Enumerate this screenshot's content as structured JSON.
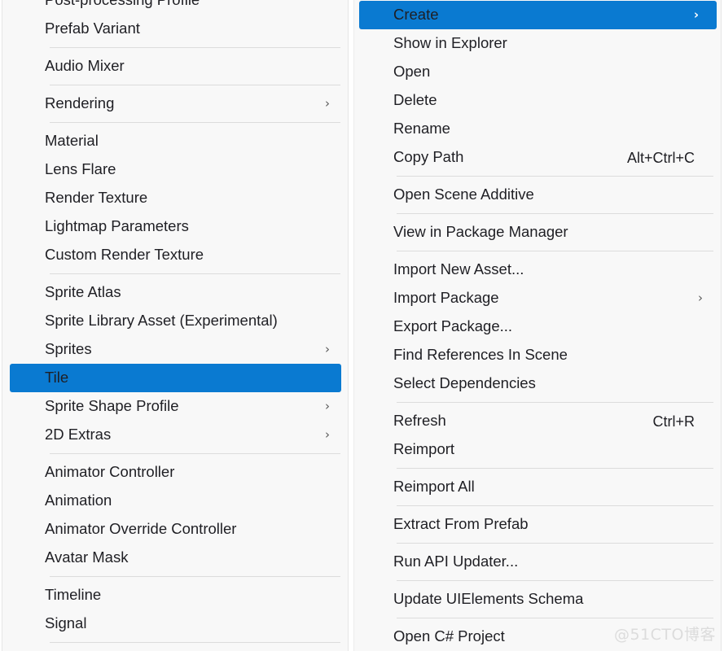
{
  "colors": {
    "highlight": "#0a7ad1",
    "panel_bg": "#f8f8f8",
    "text": "#1f1f24",
    "disabled_text": "#a8a8a8",
    "separator": "#dcdcdc",
    "watermark": "#dcdcdc"
  },
  "watermark": {
    "text": "@51CTO博客"
  },
  "icons": {
    "submenu_arrow": "›"
  },
  "left_menu": {
    "name": "create-submenu",
    "items": [
      {
        "type": "item",
        "label": "Post-processing Profile",
        "disabled": false,
        "submenu": false,
        "highlight": false,
        "shortcut": ""
      },
      {
        "type": "item",
        "label": "Prefab Variant",
        "disabled": true,
        "submenu": false,
        "highlight": false,
        "shortcut": ""
      },
      {
        "type": "separator"
      },
      {
        "type": "item",
        "label": "Audio Mixer",
        "disabled": false,
        "submenu": false,
        "highlight": false,
        "shortcut": ""
      },
      {
        "type": "separator"
      },
      {
        "type": "item",
        "label": "Rendering",
        "disabled": false,
        "submenu": true,
        "highlight": false,
        "shortcut": ""
      },
      {
        "type": "separator"
      },
      {
        "type": "item",
        "label": "Material",
        "disabled": false,
        "submenu": false,
        "highlight": false,
        "shortcut": ""
      },
      {
        "type": "item",
        "label": "Lens Flare",
        "disabled": false,
        "submenu": false,
        "highlight": false,
        "shortcut": ""
      },
      {
        "type": "item",
        "label": "Render Texture",
        "disabled": false,
        "submenu": false,
        "highlight": false,
        "shortcut": ""
      },
      {
        "type": "item",
        "label": "Lightmap Parameters",
        "disabled": false,
        "submenu": false,
        "highlight": false,
        "shortcut": ""
      },
      {
        "type": "item",
        "label": "Custom Render Texture",
        "disabled": false,
        "submenu": false,
        "highlight": false,
        "shortcut": ""
      },
      {
        "type": "separator"
      },
      {
        "type": "item",
        "label": "Sprite Atlas",
        "disabled": false,
        "submenu": false,
        "highlight": false,
        "shortcut": ""
      },
      {
        "type": "item",
        "label": "Sprite Library Asset (Experimental)",
        "disabled": false,
        "submenu": false,
        "highlight": false,
        "shortcut": ""
      },
      {
        "type": "item",
        "label": "Sprites",
        "disabled": false,
        "submenu": true,
        "highlight": false,
        "shortcut": ""
      },
      {
        "type": "item",
        "label": "Tile",
        "disabled": false,
        "submenu": false,
        "highlight": true,
        "shortcut": ""
      },
      {
        "type": "item",
        "label": "Sprite Shape Profile",
        "disabled": false,
        "submenu": true,
        "highlight": false,
        "shortcut": ""
      },
      {
        "type": "item",
        "label": "2D Extras",
        "disabled": false,
        "submenu": true,
        "highlight": false,
        "shortcut": ""
      },
      {
        "type": "separator"
      },
      {
        "type": "item",
        "label": "Animator Controller",
        "disabled": false,
        "submenu": false,
        "highlight": false,
        "shortcut": ""
      },
      {
        "type": "item",
        "label": "Animation",
        "disabled": false,
        "submenu": false,
        "highlight": false,
        "shortcut": ""
      },
      {
        "type": "item",
        "label": "Animator Override Controller",
        "disabled": false,
        "submenu": false,
        "highlight": false,
        "shortcut": ""
      },
      {
        "type": "item",
        "label": "Avatar Mask",
        "disabled": false,
        "submenu": false,
        "highlight": false,
        "shortcut": ""
      },
      {
        "type": "separator"
      },
      {
        "type": "item",
        "label": "Timeline",
        "disabled": false,
        "submenu": false,
        "highlight": false,
        "shortcut": ""
      },
      {
        "type": "item",
        "label": "Signal",
        "disabled": false,
        "submenu": false,
        "highlight": false,
        "shortcut": ""
      },
      {
        "type": "separator"
      }
    ]
  },
  "right_menu": {
    "name": "project-context-menu",
    "items": [
      {
        "type": "item",
        "label": "Create",
        "disabled": false,
        "submenu": true,
        "highlight": true,
        "shortcut": ""
      },
      {
        "type": "item",
        "label": "Show in Explorer",
        "disabled": false,
        "submenu": false,
        "highlight": false,
        "shortcut": ""
      },
      {
        "type": "item",
        "label": "Open",
        "disabled": false,
        "submenu": false,
        "highlight": false,
        "shortcut": ""
      },
      {
        "type": "item",
        "label": "Delete",
        "disabled": false,
        "submenu": false,
        "highlight": false,
        "shortcut": ""
      },
      {
        "type": "item",
        "label": "Rename",
        "disabled": false,
        "submenu": false,
        "highlight": false,
        "shortcut": ""
      },
      {
        "type": "item",
        "label": "Copy Path",
        "disabled": false,
        "submenu": false,
        "highlight": false,
        "shortcut": "Alt+Ctrl+C"
      },
      {
        "type": "separator"
      },
      {
        "type": "item",
        "label": "Open Scene Additive",
        "disabled": true,
        "submenu": false,
        "highlight": false,
        "shortcut": ""
      },
      {
        "type": "separator"
      },
      {
        "type": "item",
        "label": "View in Package Manager",
        "disabled": true,
        "submenu": false,
        "highlight": false,
        "shortcut": ""
      },
      {
        "type": "separator"
      },
      {
        "type": "item",
        "label": "Import New Asset...",
        "disabled": false,
        "submenu": false,
        "highlight": false,
        "shortcut": ""
      },
      {
        "type": "item",
        "label": "Import Package",
        "disabled": false,
        "submenu": true,
        "highlight": false,
        "shortcut": ""
      },
      {
        "type": "item",
        "label": "Export Package...",
        "disabled": false,
        "submenu": false,
        "highlight": false,
        "shortcut": ""
      },
      {
        "type": "item",
        "label": "Find References In Scene",
        "disabled": true,
        "submenu": false,
        "highlight": false,
        "shortcut": ""
      },
      {
        "type": "item",
        "label": "Select Dependencies",
        "disabled": false,
        "submenu": false,
        "highlight": false,
        "shortcut": ""
      },
      {
        "type": "separator"
      },
      {
        "type": "item",
        "label": "Refresh",
        "disabled": false,
        "submenu": false,
        "highlight": false,
        "shortcut": "Ctrl+R"
      },
      {
        "type": "item",
        "label": "Reimport",
        "disabled": false,
        "submenu": false,
        "highlight": false,
        "shortcut": ""
      },
      {
        "type": "separator"
      },
      {
        "type": "item",
        "label": "Reimport All",
        "disabled": false,
        "submenu": false,
        "highlight": false,
        "shortcut": ""
      },
      {
        "type": "separator"
      },
      {
        "type": "item",
        "label": "Extract From Prefab",
        "disabled": true,
        "submenu": false,
        "highlight": false,
        "shortcut": ""
      },
      {
        "type": "separator"
      },
      {
        "type": "item",
        "label": "Run API Updater...",
        "disabled": true,
        "submenu": false,
        "highlight": false,
        "shortcut": ""
      },
      {
        "type": "separator"
      },
      {
        "type": "item",
        "label": "Update UIElements Schema",
        "disabled": false,
        "submenu": false,
        "highlight": false,
        "shortcut": ""
      },
      {
        "type": "separator"
      },
      {
        "type": "item",
        "label": "Open C# Project",
        "disabled": false,
        "submenu": false,
        "highlight": false,
        "shortcut": ""
      }
    ]
  }
}
